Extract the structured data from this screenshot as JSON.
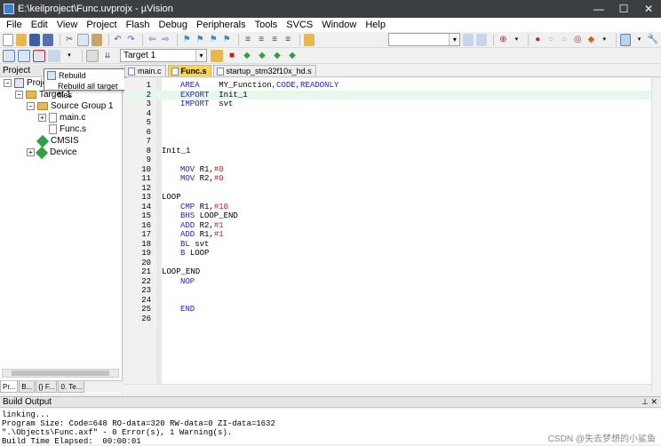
{
  "window": {
    "title": "E:\\keilproject\\Func.uvprojx - µVision",
    "controls": [
      "—",
      "☐",
      "✕"
    ]
  },
  "menu": [
    "File",
    "Edit",
    "View",
    "Project",
    "Flash",
    "Debug",
    "Peripherals",
    "Tools",
    "SVCS",
    "Window",
    "Help"
  ],
  "toolbar": {
    "target_label": "Target 1"
  },
  "tooltip": {
    "title": "Rebuild",
    "description": "Rebuild all target files"
  },
  "project_panel": {
    "header": "Project",
    "tree": {
      "project_label": "Proje",
      "target": "Target 1",
      "group": "Source Group 1",
      "files": [
        "main.c",
        "Func.s"
      ],
      "cmsis": "CMSIS",
      "device": "Device"
    },
    "tabs": [
      "Pr...",
      "B...",
      "{} F...",
      "0. Te..."
    ]
  },
  "editor": {
    "tabs": [
      "main.c",
      "Func.s",
      "startup_stm32f10x_hd.s"
    ],
    "active_tab": "Func.s"
  },
  "code": [
    {
      "n": "1",
      "t": "AREA    MY_Function,CODE,READONLY"
    },
    {
      "n": "2",
      "t": "EXPORT  Init_1"
    },
    {
      "n": "3",
      "t": "IMPORT  svt"
    },
    {
      "n": "4",
      "t": ""
    },
    {
      "n": "5",
      "t": ""
    },
    {
      "n": "6",
      "t": ""
    },
    {
      "n": "7",
      "t": ""
    },
    {
      "n": "8",
      "t": "Init_1"
    },
    {
      "n": "9",
      "t": ""
    },
    {
      "n": "10",
      "t": "MOV R1,#0"
    },
    {
      "n": "11",
      "t": "MOV R2,#0"
    },
    {
      "n": "12",
      "t": ""
    },
    {
      "n": "13",
      "t": "LOOP"
    },
    {
      "n": "14",
      "t": "CMP R1,#10"
    },
    {
      "n": "15",
      "t": "BHS LOOP_END"
    },
    {
      "n": "16",
      "t": "ADD R2,#1"
    },
    {
      "n": "17",
      "t": "ADD R1,#1"
    },
    {
      "n": "18",
      "t": "BL svt"
    },
    {
      "n": "19",
      "t": "B LOOP"
    },
    {
      "n": "20",
      "t": ""
    },
    {
      "n": "21",
      "t": "LOOP_END"
    },
    {
      "n": "22",
      "t": "NOP"
    },
    {
      "n": "23",
      "t": ""
    },
    {
      "n": "24",
      "t": ""
    },
    {
      "n": "25",
      "t": "END"
    },
    {
      "n": "26",
      "t": ""
    }
  ],
  "build_output": {
    "header": "Build Output",
    "lines": [
      "linking...",
      "Program Size: Code=648 RO-data=320 RW-data=0 ZI-data=1632",
      "\".\\Objects\\Func.axf\" - 0 Error(s), 1 Warning(s).",
      "Build Time Elapsed:  00:00:01"
    ]
  },
  "watermark": "CSDN @失去梦想的小鲨鱼",
  "colors": {
    "titlebar": "#3c3f41",
    "active_tab": "#ffd34d",
    "keyword": "#1f1fd3",
    "number": "#c21c1c",
    "highlight_line": "#e6f8ea"
  }
}
